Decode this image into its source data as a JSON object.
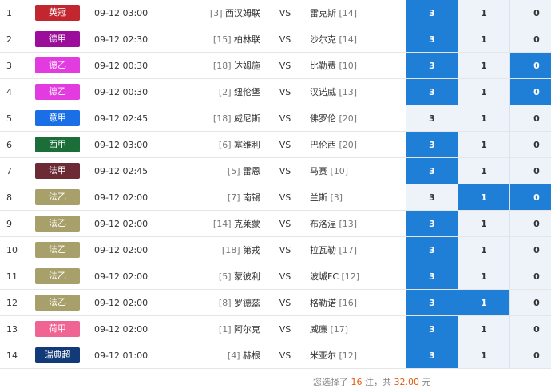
{
  "colors": {
    "selected": "#1f7fd6",
    "unselected": "#edf3f9",
    "highlight": "#e05b0e"
  },
  "matches": [
    {
      "num": "1",
      "league": "英冠",
      "league_color": "#c2262e",
      "time": "09-12 03:00",
      "home_rank": "[3]",
      "home": "西汉姆联",
      "vs": "VS",
      "away": "雷克斯",
      "away_rank": "[14]",
      "opt_3": "3",
      "opt_1": "1",
      "opt_0": "0",
      "sel_3": true,
      "sel_1": false,
      "sel_0": false
    },
    {
      "num": "2",
      "league": "德甲",
      "league_color": "#9a0e9a",
      "time": "09-12 02:30",
      "home_rank": "[15]",
      "home": "柏林联",
      "vs": "VS",
      "away": "沙尔克",
      "away_rank": "[14]",
      "opt_3": "3",
      "opt_1": "1",
      "opt_0": "0",
      "sel_3": true,
      "sel_1": false,
      "sel_0": false
    },
    {
      "num": "3",
      "league": "德乙",
      "league_color": "#e23ce0",
      "time": "09-12 00:30",
      "home_rank": "[18]",
      "home": "达姆施",
      "vs": "VS",
      "away": "比勒费",
      "away_rank": "[10]",
      "opt_3": "3",
      "opt_1": "1",
      "opt_0": "0",
      "sel_3": true,
      "sel_1": false,
      "sel_0": true
    },
    {
      "num": "4",
      "league": "德乙",
      "league_color": "#e23ce0",
      "time": "09-12 00:30",
      "home_rank": "[2]",
      "home": "纽伦堡",
      "vs": "VS",
      "away": "汉诺威",
      "away_rank": "[13]",
      "opt_3": "3",
      "opt_1": "1",
      "opt_0": "0",
      "sel_3": true,
      "sel_1": false,
      "sel_0": true
    },
    {
      "num": "5",
      "league": "意甲",
      "league_color": "#1a6fe6",
      "time": "09-12 02:45",
      "home_rank": "[18]",
      "home": "威尼斯",
      "vs": "VS",
      "away": "佛罗伦",
      "away_rank": "[20]",
      "opt_3": "3",
      "opt_1": "1",
      "opt_0": "0",
      "sel_3": false,
      "sel_1": false,
      "sel_0": false
    },
    {
      "num": "6",
      "league": "西甲",
      "league_color": "#1c6e38",
      "time": "09-12 03:00",
      "home_rank": "[6]",
      "home": "塞维利",
      "vs": "VS",
      "away": "巴伦西",
      "away_rank": "[20]",
      "opt_3": "3",
      "opt_1": "1",
      "opt_0": "0",
      "sel_3": true,
      "sel_1": false,
      "sel_0": false
    },
    {
      "num": "7",
      "league": "法甲",
      "league_color": "#6b2a34",
      "time": "09-12 02:45",
      "home_rank": "[5]",
      "home": "雷恩",
      "vs": "VS",
      "away": "马赛",
      "away_rank": "[10]",
      "opt_3": "3",
      "opt_1": "1",
      "opt_0": "0",
      "sel_3": true,
      "sel_1": false,
      "sel_0": false
    },
    {
      "num": "8",
      "league": "法乙",
      "league_color": "#a8a06a",
      "time": "09-12 02:00",
      "home_rank": "[7]",
      "home": "南锡",
      "vs": "VS",
      "away": "兰斯",
      "away_rank": "[3]",
      "opt_3": "3",
      "opt_1": "1",
      "opt_0": "0",
      "sel_3": false,
      "sel_1": true,
      "sel_0": true
    },
    {
      "num": "9",
      "league": "法乙",
      "league_color": "#a8a06a",
      "time": "09-12 02:00",
      "home_rank": "[14]",
      "home": "克莱蒙",
      "vs": "VS",
      "away": "布洛涅",
      "away_rank": "[13]",
      "opt_3": "3",
      "opt_1": "1",
      "opt_0": "0",
      "sel_3": true,
      "sel_1": false,
      "sel_0": false
    },
    {
      "num": "10",
      "league": "法乙",
      "league_color": "#a8a06a",
      "time": "09-12 02:00",
      "home_rank": "[18]",
      "home": "第戎",
      "vs": "VS",
      "away": "拉瓦勒",
      "away_rank": "[17]",
      "opt_3": "3",
      "opt_1": "1",
      "opt_0": "0",
      "sel_3": true,
      "sel_1": false,
      "sel_0": false
    },
    {
      "num": "11",
      "league": "法乙",
      "league_color": "#a8a06a",
      "time": "09-12 02:00",
      "home_rank": "[5]",
      "home": "蒙彼利",
      "vs": "VS",
      "away": "波城FC",
      "away_rank": "[12]",
      "opt_3": "3",
      "opt_1": "1",
      "opt_0": "0",
      "sel_3": true,
      "sel_1": false,
      "sel_0": false
    },
    {
      "num": "12",
      "league": "法乙",
      "league_color": "#a8a06a",
      "time": "09-12 02:00",
      "home_rank": "[8]",
      "home": "罗德兹",
      "vs": "VS",
      "away": "格勒诺",
      "away_rank": "[16]",
      "opt_3": "3",
      "opt_1": "1",
      "opt_0": "0",
      "sel_3": true,
      "sel_1": true,
      "sel_0": false
    },
    {
      "num": "13",
      "league": "荷甲",
      "league_color": "#f06494",
      "time": "09-12 02:00",
      "home_rank": "[1]",
      "home": "阿尔克",
      "vs": "VS",
      "away": "威廉",
      "away_rank": "[17]",
      "opt_3": "3",
      "opt_1": "1",
      "opt_0": "0",
      "sel_3": true,
      "sel_1": false,
      "sel_0": false
    },
    {
      "num": "14",
      "league": "瑞典超",
      "league_color": "#123a78",
      "time": "09-12 01:00",
      "home_rank": "[4]",
      "home": "赫根",
      "vs": "VS",
      "away": "米亚尔",
      "away_rank": "[12]",
      "opt_3": "3",
      "opt_1": "1",
      "opt_0": "0",
      "sel_3": true,
      "sel_1": false,
      "sel_0": false
    }
  ],
  "summary": {
    "prefix": "您选择了",
    "count": "16",
    "mid": "注，共",
    "amount": "32.00",
    "suffix": "元"
  }
}
